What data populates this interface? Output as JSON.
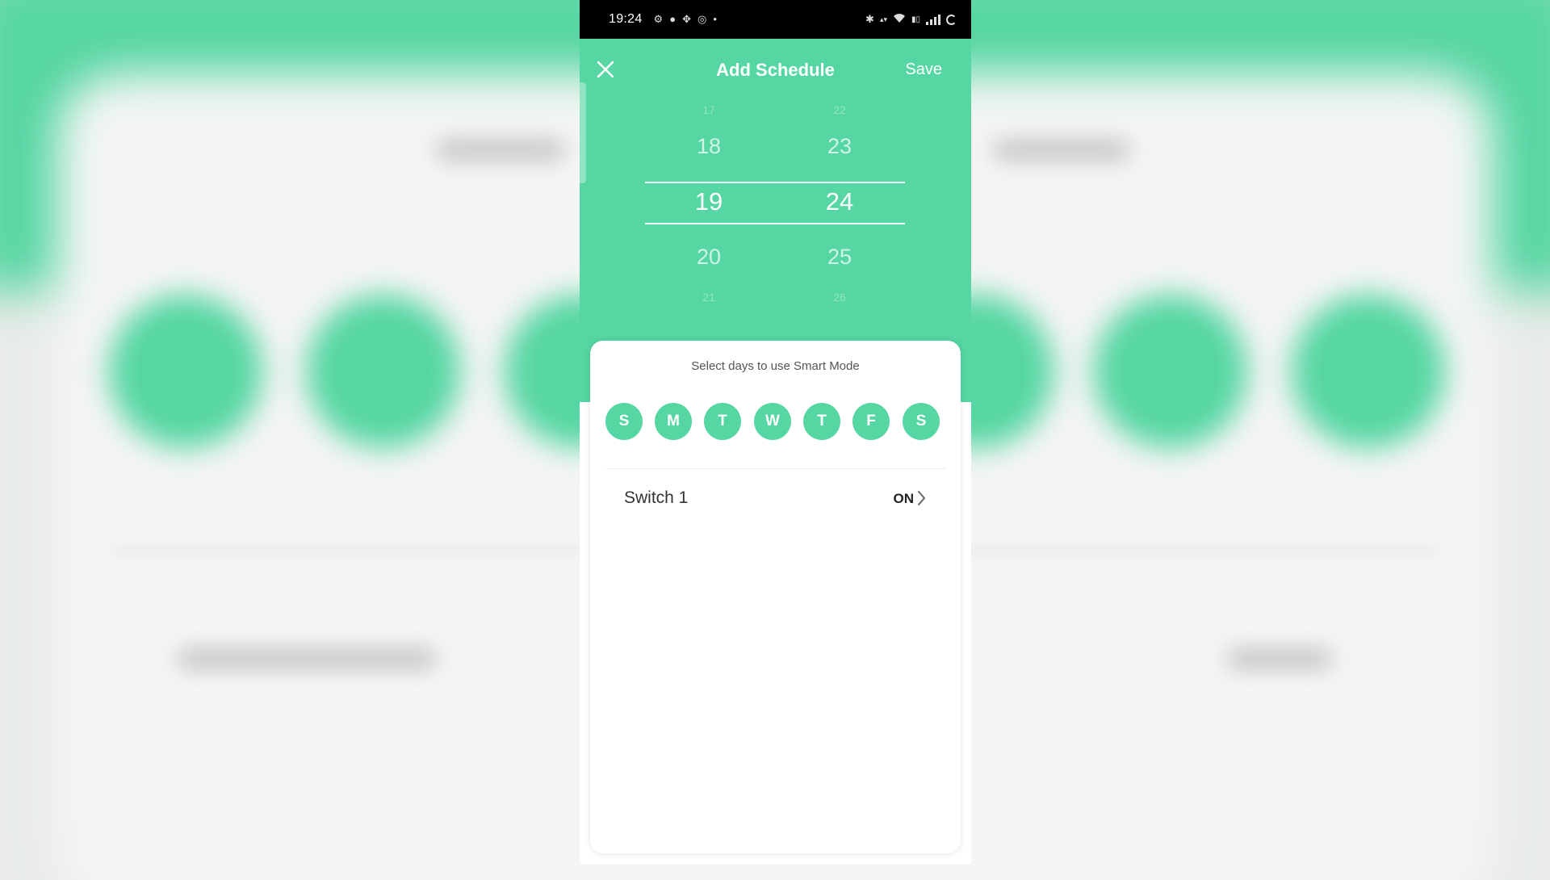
{
  "colors": {
    "accent": "#55d6a2",
    "card": "#ffffff",
    "statusbar": "#000000"
  },
  "status_bar": {
    "time": "19:24",
    "left_icons": [
      "settings-icon",
      "chat-icon",
      "grid-icon",
      "whatsapp-icon",
      "dot-icon"
    ],
    "right_icons": [
      "bluetooth-icon",
      "data-speed-icon",
      "wifi-icon",
      "volte-icon",
      "signal-icon",
      "battery-icon"
    ]
  },
  "header": {
    "title": "Add Schedule",
    "save_label": "Save",
    "close_icon": "close-icon"
  },
  "time_picker": {
    "hours": {
      "prev_far": "17",
      "prev": "18",
      "selected": "19",
      "next": "20",
      "next_far": "21"
    },
    "minutes": {
      "prev_far": "22",
      "prev": "23",
      "selected": "24",
      "next": "25",
      "next_far": "26"
    }
  },
  "days_card": {
    "hint": "Select days to use Smart Mode",
    "days": [
      "S",
      "M",
      "T",
      "W",
      "T",
      "F",
      "S"
    ]
  },
  "switch_row": {
    "label": "Switch 1",
    "value": "ON",
    "chevron_icon": "chevron-right-icon"
  }
}
